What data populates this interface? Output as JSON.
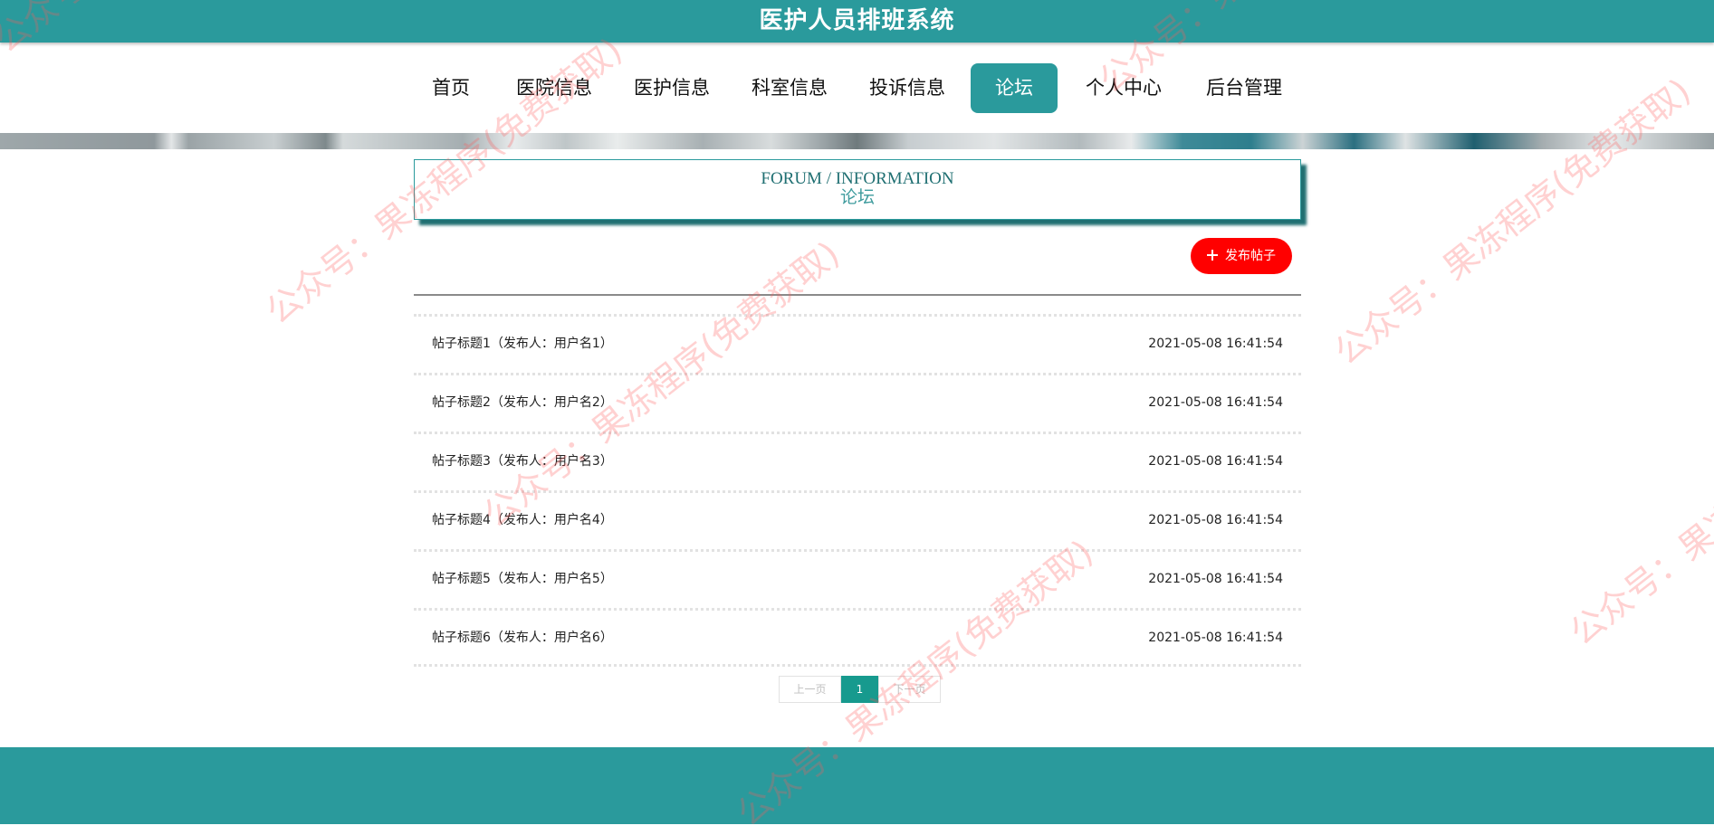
{
  "header": {
    "title": "医护人员排班系统"
  },
  "nav": {
    "items": [
      {
        "label": "首页"
      },
      {
        "label": "医院信息"
      },
      {
        "label": "医护信息"
      },
      {
        "label": "科室信息"
      },
      {
        "label": "投诉信息"
      },
      {
        "label": "论坛",
        "active": true
      },
      {
        "label": "个人中心"
      },
      {
        "label": "后台管理"
      }
    ]
  },
  "section": {
    "title_en": "FORUM / INFORMATION",
    "title_cn": "论坛"
  },
  "actions": {
    "publish_label": "发布帖子"
  },
  "posts": [
    {
      "title": "帖子标题1（发布人：用户名1）",
      "time": "2021-05-08 16:41:54"
    },
    {
      "title": "帖子标题2（发布人：用户名2）",
      "time": "2021-05-08 16:41:54"
    },
    {
      "title": "帖子标题3（发布人：用户名3）",
      "time": "2021-05-08 16:41:54"
    },
    {
      "title": "帖子标题4（发布人：用户名4）",
      "time": "2021-05-08 16:41:54"
    },
    {
      "title": "帖子标题5（发布人：用户名5）",
      "time": "2021-05-08 16:41:54"
    },
    {
      "title": "帖子标题6（发布人：用户名6）",
      "time": "2021-05-08 16:41:54"
    }
  ],
  "pagination": {
    "prev_label": "上一页",
    "current_page": "1",
    "next_label": "下一页"
  },
  "watermark": {
    "text": "公众号：果冻程序(免费获取)"
  },
  "colors": {
    "primary": "#2a9a9c",
    "publish_button": "#ff0000",
    "pagination_active": "#179a8e"
  }
}
